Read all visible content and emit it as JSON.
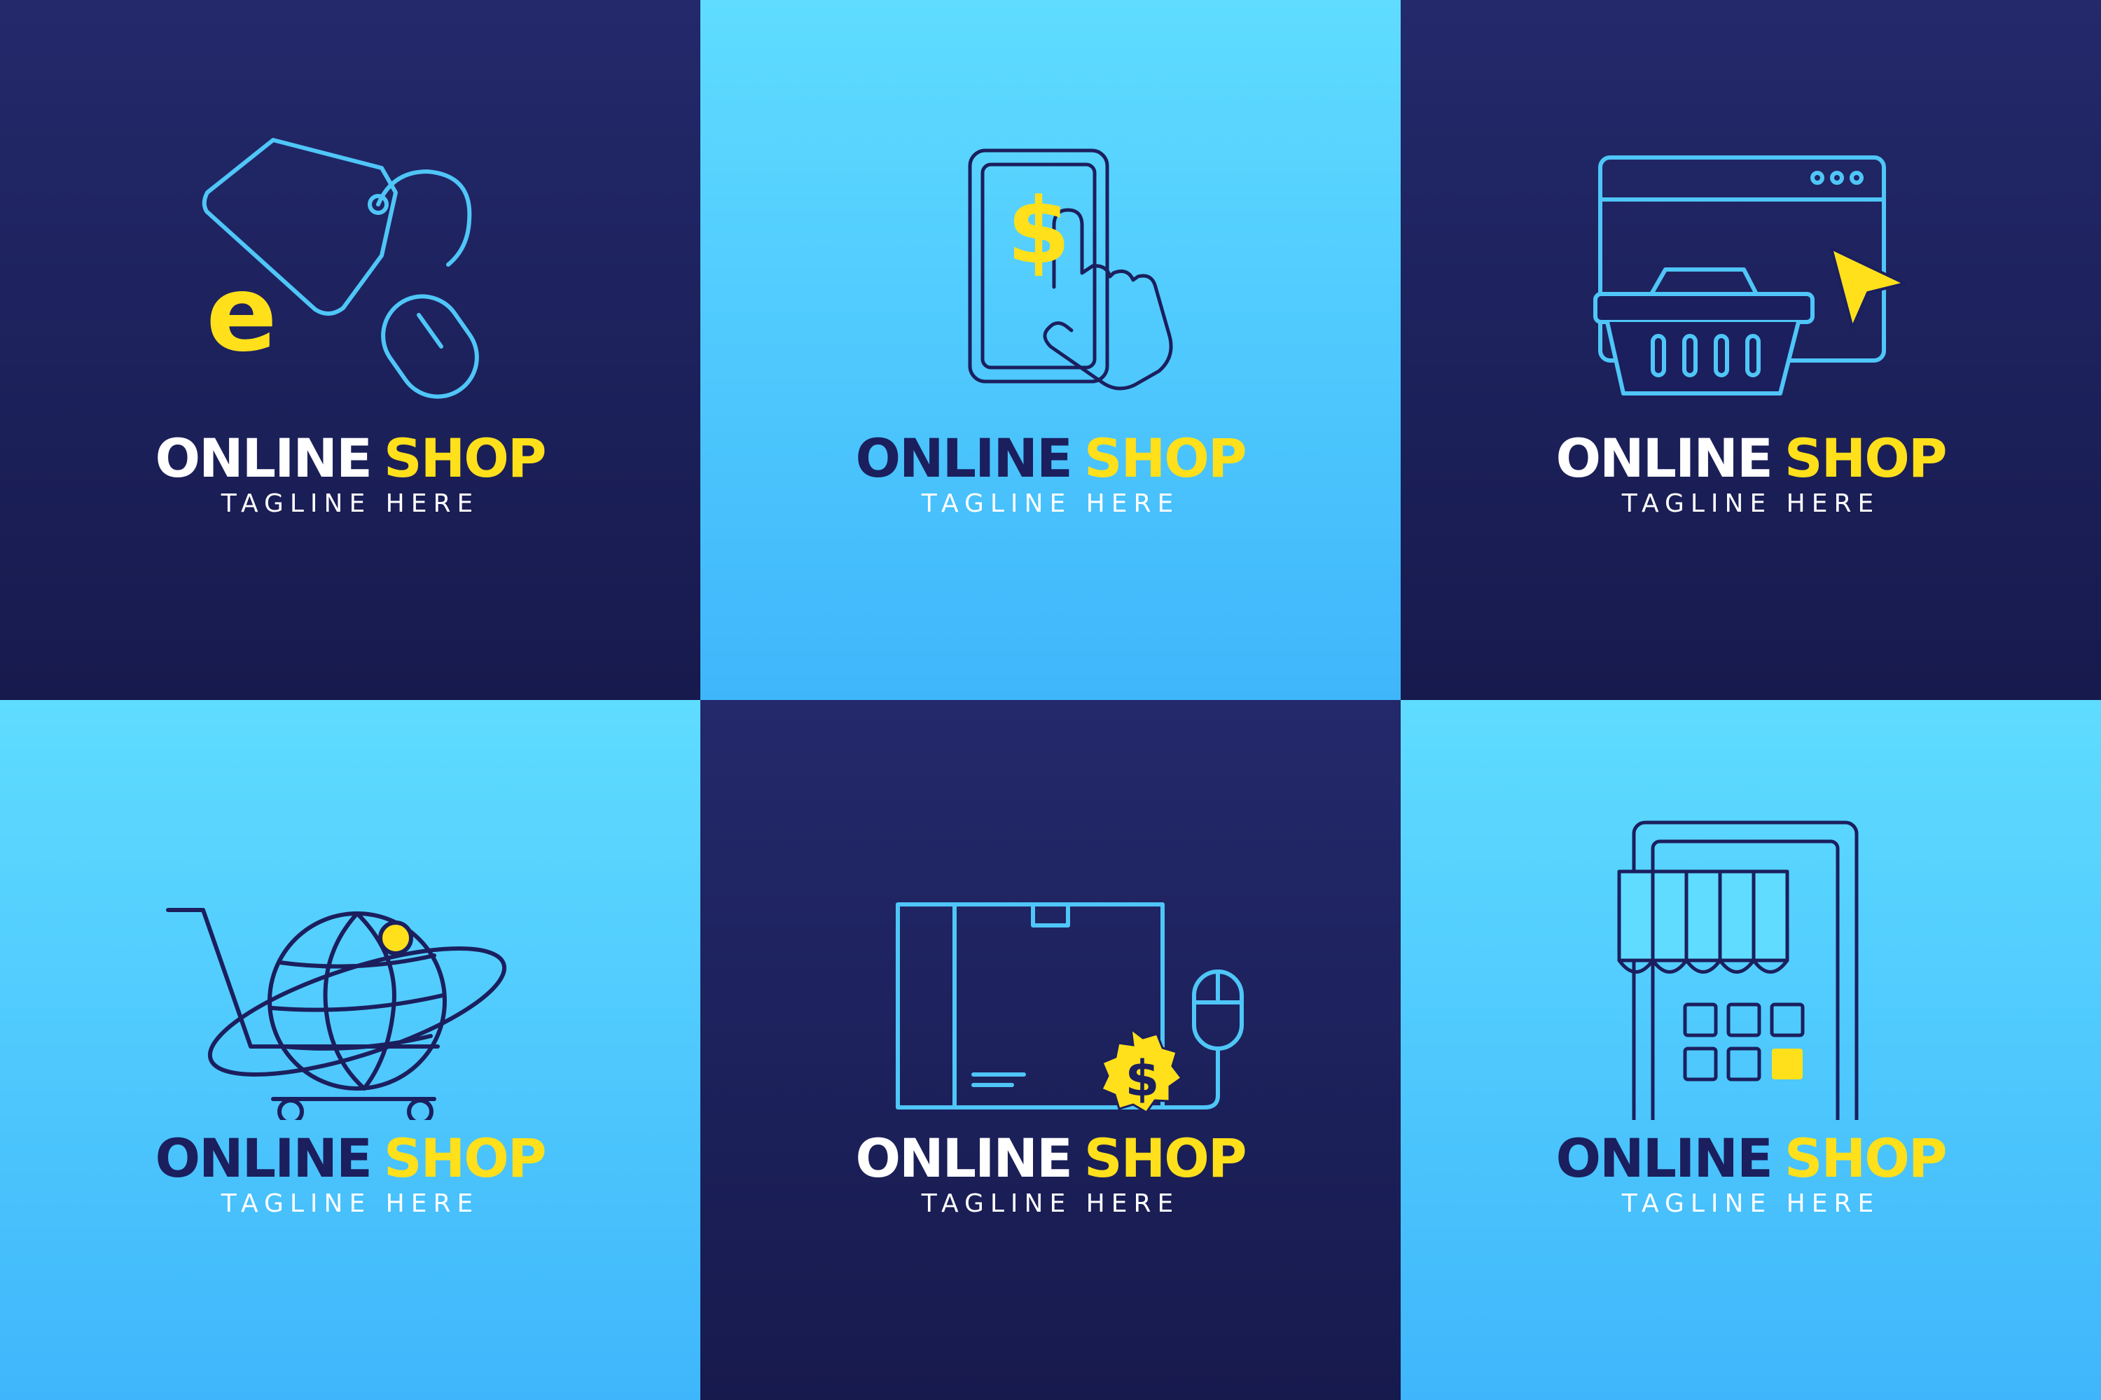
{
  "colors": {
    "navy": "#1b1f5e",
    "dark_navy": "#171a4d",
    "sky": "#5fdcff",
    "cyan_line": "#4fc6f7",
    "yellow": "#ffe01b",
    "white": "#ffffff"
  },
  "logos": [
    {
      "word1": "ONLINE",
      "word2": "SHOP",
      "tagline": "TAGLINE HERE",
      "icon": "price-tag-e-mouse",
      "glyph": "e"
    },
    {
      "word1": "ONLINE",
      "word2": "SHOP",
      "tagline": "TAGLINE HERE",
      "icon": "smartphone-dollar-tap",
      "glyph": "$"
    },
    {
      "word1": "ONLINE",
      "word2": "SHOP",
      "tagline": "TAGLINE HERE",
      "icon": "browser-basket-cursor"
    },
    {
      "word1": "ONLINE",
      "word2": "SHOP",
      "tagline": "TAGLINE HERE",
      "icon": "globe-shopping-cart"
    },
    {
      "word1": "ONLINE",
      "word2": "SHOP",
      "tagline": "TAGLINE HERE",
      "icon": "parcel-box-mouse-dollar",
      "glyph": "$"
    },
    {
      "word1": "ONLINE",
      "word2": "SHOP",
      "tagline": "TAGLINE HERE",
      "icon": "tablet-storefront"
    }
  ]
}
